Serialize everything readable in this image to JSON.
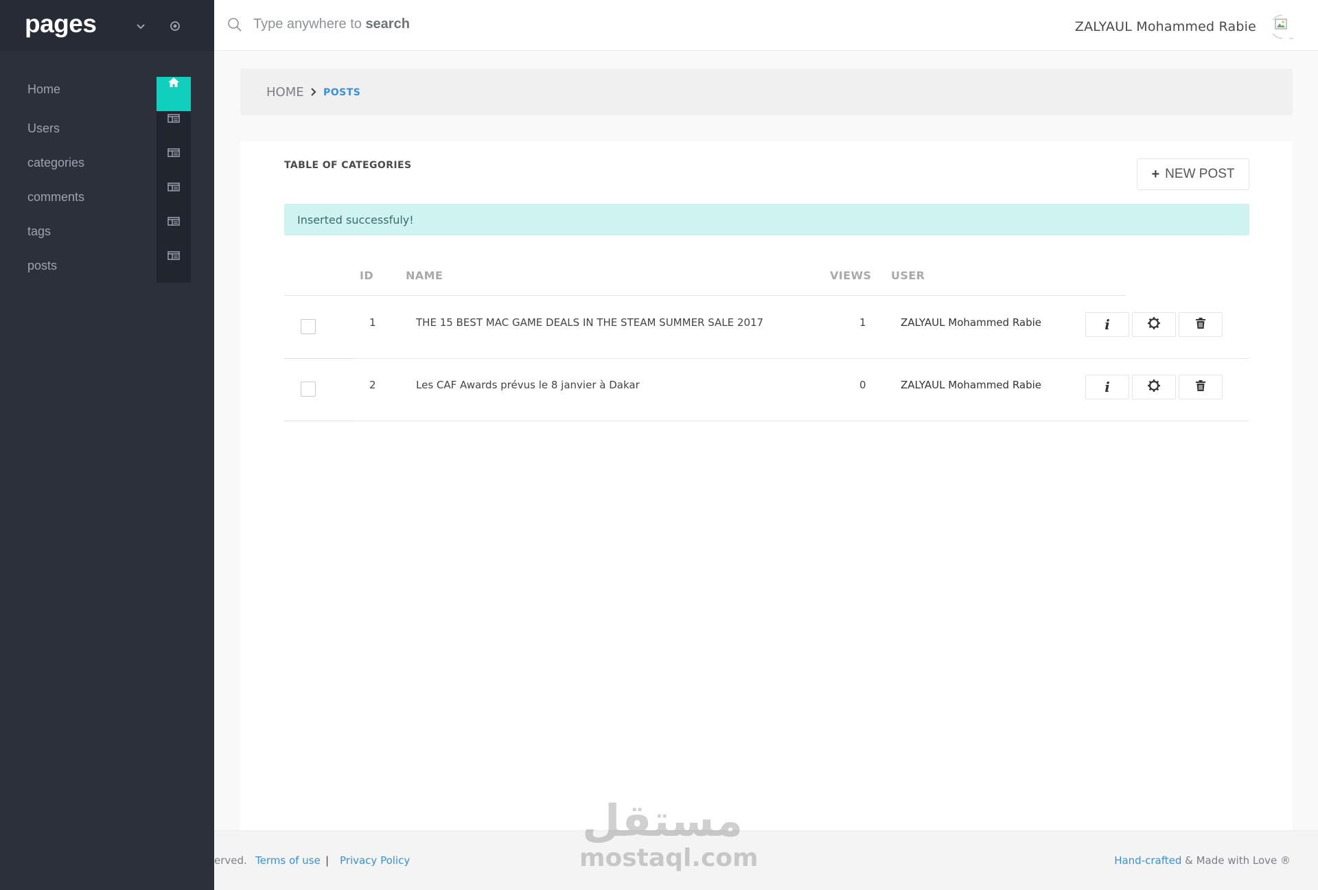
{
  "sidebar": {
    "brand": "pages",
    "items": [
      {
        "label": "Home"
      },
      {
        "label": "Users"
      },
      {
        "label": "categories"
      },
      {
        "label": "comments"
      },
      {
        "label": "tags"
      },
      {
        "label": "posts"
      }
    ],
    "active_index": 0,
    "accent_color": "#10cfbd",
    "background_color": "#2b303b"
  },
  "topbar": {
    "search_prefix": "Type anywhere to ",
    "search_bold": "search",
    "user_name": "ZALYAUL Mohammed Rabie"
  },
  "breadcrumb": {
    "home": "HOME",
    "current": "POSTS"
  },
  "card": {
    "title": "TABLE OF CATEGORIES",
    "new_button_plus": "+",
    "new_button_label": "NEW POST",
    "alert_text": "Inserted successfuly!",
    "alert_color": "#cef3f0"
  },
  "table": {
    "columns": [
      "ID",
      "NAME",
      "VIEWS",
      "USER"
    ],
    "rows": [
      {
        "id": "1",
        "name": "THE 15 BEST MAC GAME DEALS IN THE STEAM SUMMER SALE 2017",
        "views": "1",
        "user": "ZALYAUL Mohammed Rabie"
      },
      {
        "id": "2",
        "name": "Les CAF Awards prévus le 8 janvier à Dakar",
        "views": "0",
        "user": "ZALYAUL Mohammed Rabie"
      }
    ],
    "action_icons": [
      "info-icon",
      "gear-icon",
      "trash-icon"
    ],
    "info_glyph": "i"
  },
  "footer": {
    "copyright_fragment": "erved.",
    "terms": "Terms of use",
    "separator": "|",
    "privacy": "Privacy Policy",
    "handcrafted": "Hand-crafted",
    "made_with": " & Made with Love ®"
  },
  "watermark": {
    "arabic": "مستقل",
    "latin": "mostaql.com"
  }
}
